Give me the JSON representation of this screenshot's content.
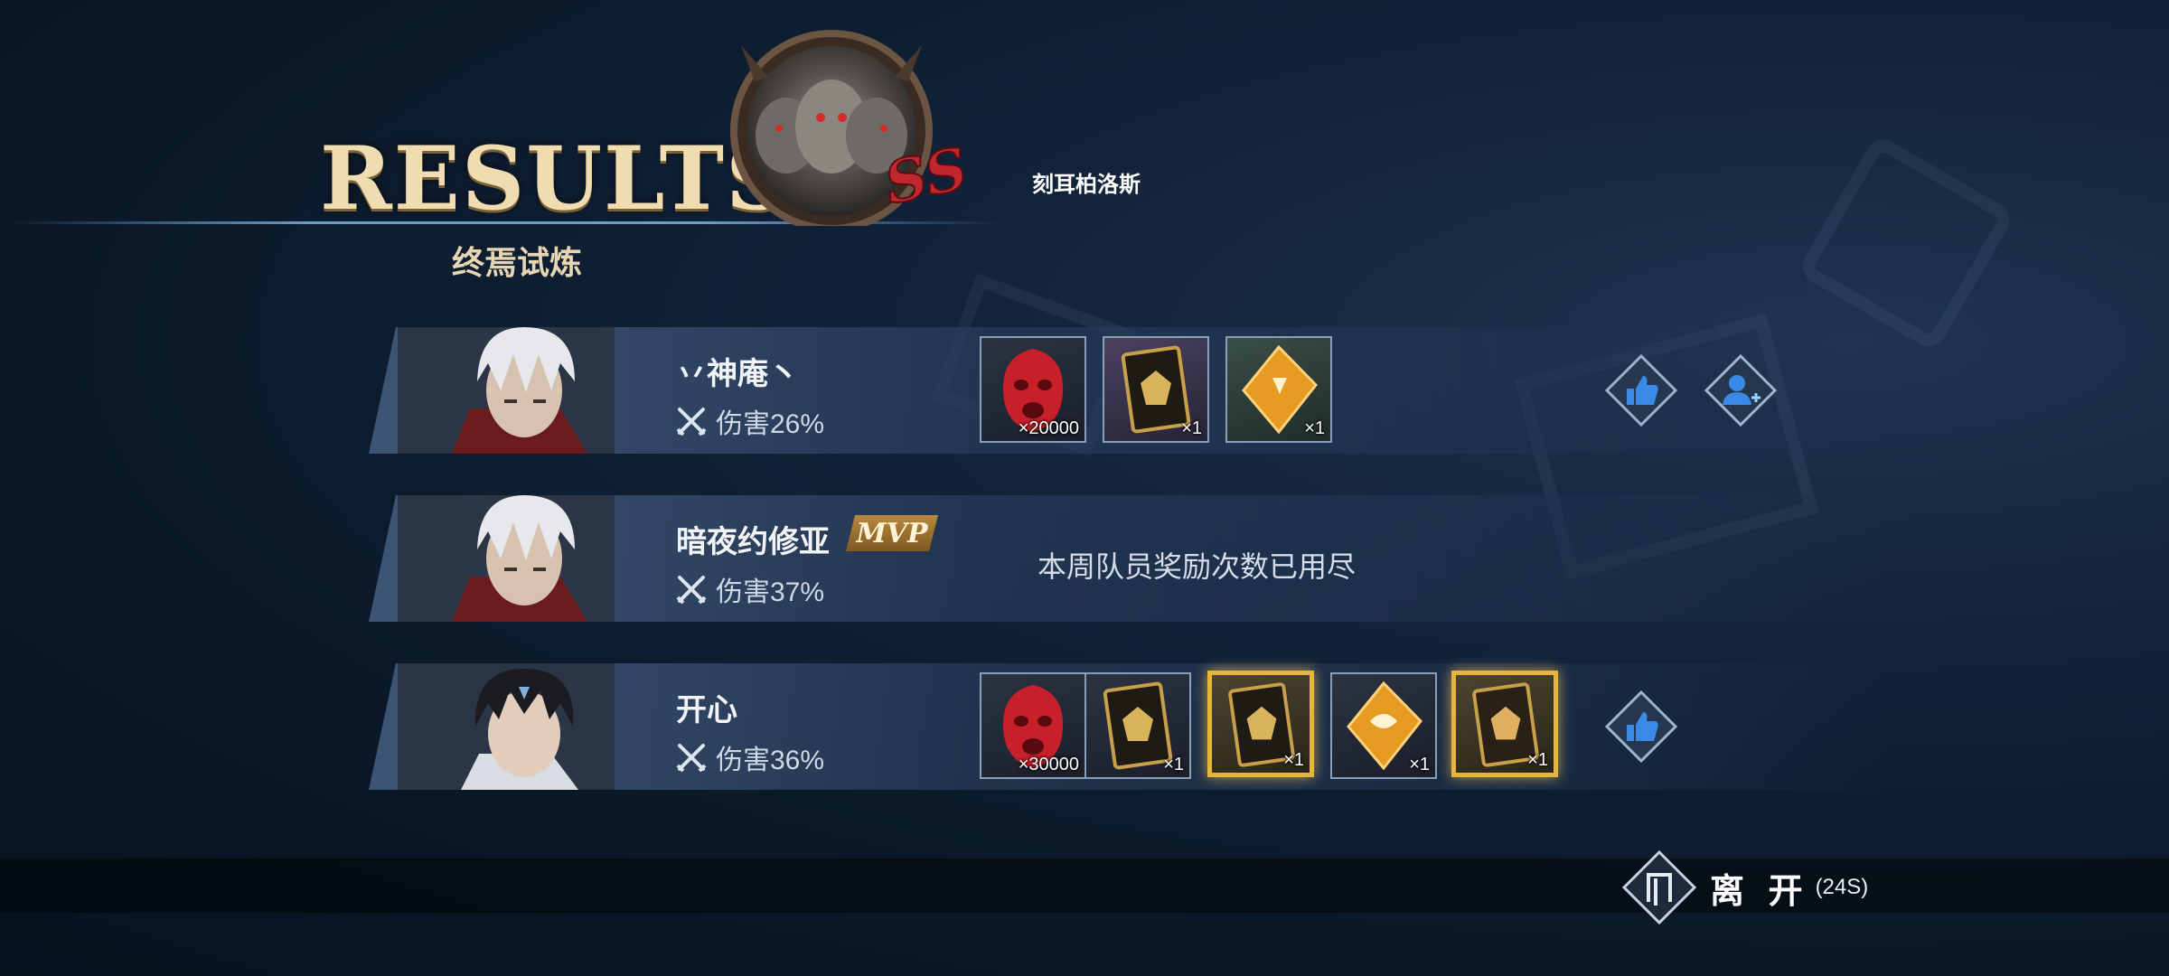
{
  "header": {
    "title": "RESULTS",
    "subtitle": "终焉试炼",
    "boss_name": "刻耳柏洛斯",
    "boss_icon": "three-headed-dog-emblem",
    "rank_mark": "SSS"
  },
  "players": [
    {
      "name": "丷神庵丶",
      "damage_label": "伤害26%",
      "avatar_icon": "white-haired-warrior-portrait",
      "mvp": false,
      "rewards": [
        {
          "icon": "red-mask-item",
          "qty": "×20000"
        },
        {
          "icon": "gold-emblem-card",
          "qty": "×1"
        },
        {
          "icon": "orange-crystal",
          "qty": "×1"
        }
      ]
    },
    {
      "name": "暗夜约修亚",
      "damage_label": "伤害37%",
      "avatar_icon": "white-haired-warrior-portrait",
      "mvp": true,
      "mvp_label": "MVP",
      "notice": "本周队员奖励次数已用尽"
    },
    {
      "name": "开心",
      "damage_label": "伤害36%",
      "avatar_icon": "dark-haired-warrior-portrait",
      "mvp": false,
      "rewards": [
        {
          "icon": "red-mask-item",
          "qty": "×30000"
        },
        {
          "icon": "gold-emblem-card",
          "qty": "×1"
        },
        {
          "icon": "gold-emblem-card",
          "qty": "×1"
        },
        {
          "icon": "orange-crystal",
          "qty": "×1"
        },
        {
          "icon": "gold-emblem-card",
          "qty": "×1"
        }
      ]
    }
  ],
  "leave": {
    "label": "离 开",
    "timer": "(24S)"
  },
  "colors": {
    "accent_gold": "#e6b63a",
    "title_gold": "#efdcb0",
    "button_blue": "#3a7fd6"
  }
}
